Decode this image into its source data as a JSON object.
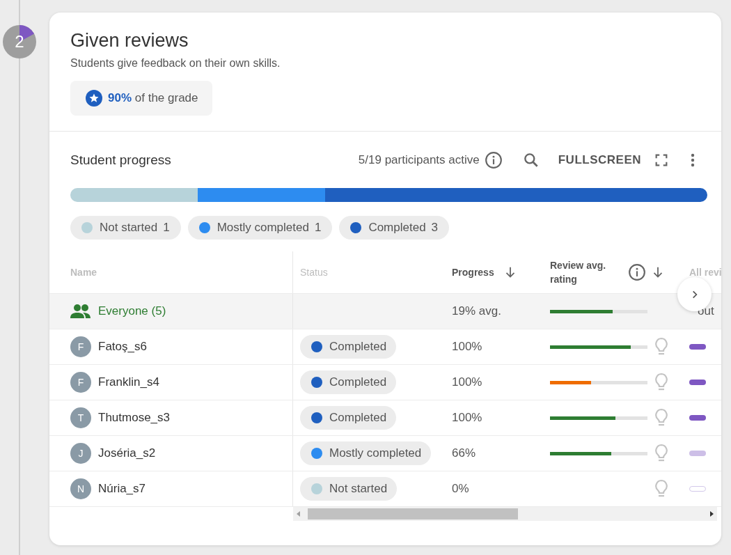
{
  "step": {
    "number": "2"
  },
  "card": {
    "title": "Given reviews",
    "subtitle": "Students give feedback on their own skills.",
    "grade": {
      "value": "90%",
      "text": "of the grade"
    }
  },
  "progress": {
    "title": "Student progress",
    "active": "5/19 participants active",
    "fullscreen": "FULLSCREEN",
    "legend": [
      {
        "label": "Not started",
        "count": "1",
        "color": "#b7d3da",
        "level": 0.2
      },
      {
        "label": "Mostly completed",
        "count": "1",
        "color": "#2d8cf0",
        "level": 0.2
      },
      {
        "label": "Completed",
        "count": "3",
        "color": "#1f5fbf",
        "level": 0.6
      }
    ]
  },
  "table": {
    "columns": [
      "Name",
      "Status",
      "Progress",
      "Review avg. rating",
      "All revi"
    ],
    "summary": {
      "name": "Everyone (5)",
      "progress": "19% avg.",
      "rating": {
        "level": 0.64,
        "color": "#2e7d32"
      },
      "reviews": "out"
    },
    "rows": [
      {
        "initial": "F",
        "name": "Fatoş_s6",
        "status": {
          "label": "Completed",
          "color": "#1f5fbf"
        },
        "progress": "100%",
        "rating": {
          "level": 0.83,
          "color": "#2e7d32"
        },
        "reviews_started": true,
        "reviews_done": true
      },
      {
        "initial": "F",
        "name": "Franklin_s4",
        "status": {
          "label": "Completed",
          "color": "#1f5fbf"
        },
        "progress": "100%",
        "rating": {
          "level": 0.42,
          "color": "#ef6c00"
        },
        "reviews_started": true,
        "reviews_done": true
      },
      {
        "initial": "T",
        "name": "Thutmose_s3",
        "status": {
          "label": "Completed",
          "color": "#1f5fbf"
        },
        "progress": "100%",
        "rating": {
          "level": 0.67,
          "color": "#2e7d32"
        },
        "reviews_started": true,
        "reviews_done": true
      },
      {
        "initial": "J",
        "name": "Joséria_s2",
        "status": {
          "label": "Mostly completed",
          "color": "#2d8cf0"
        },
        "progress": "66%",
        "rating": {
          "level": 0.63,
          "color": "#2e7d32"
        },
        "reviews_started": true,
        "reviews_done": false
      },
      {
        "initial": "N",
        "name": "Núria_s7",
        "status": {
          "label": "Not started",
          "color": "#b7d3da"
        },
        "progress": "0%",
        "reviews_started": false,
        "reviews_done": false
      }
    ]
  }
}
